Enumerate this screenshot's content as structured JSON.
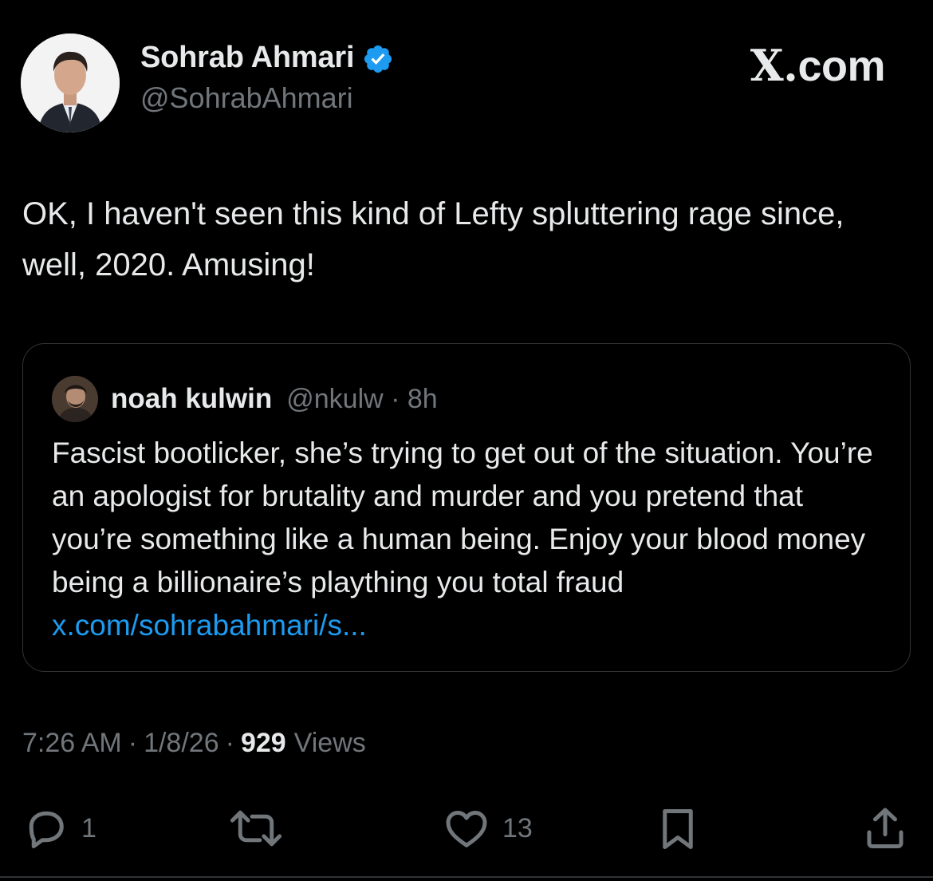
{
  "header": {
    "display_name": "Sohrab Ahmari",
    "handle": "@SohrabAhmari",
    "brand": "com",
    "brand_prefix": "X."
  },
  "tweet": {
    "text": "OK, I haven't seen this kind of Lefty spluttering rage since, well, 2020. Amusing!"
  },
  "quote": {
    "name": "noah kulwin",
    "handle_time": "@nkulw · 8h",
    "text": "Fascist bootlicker, she’s trying to get out of the situation. You’re an apologist for brutality and murder and you pretend that you’re something like a human being. Enjoy your blood money being a billionaire’s plaything you total fraud ",
    "link": "x.com/sohrabahmari/s..."
  },
  "meta": {
    "time": "7:26 AM",
    "date": "1/8/26",
    "separator": "·",
    "views_count": "929",
    "views_label": "Views"
  },
  "actions": {
    "reply_count": "1",
    "like_count": "13"
  },
  "colors": {
    "background": "#000000",
    "text": "#e7e9ea",
    "muted": "#71767b",
    "link": "#1d9bf0",
    "verified": "#1d9bf0",
    "border": "#2f3336"
  },
  "icons": [
    "verified-badge-icon",
    "reply-icon",
    "repost-icon",
    "like-icon",
    "bookmark-icon",
    "share-icon"
  ]
}
